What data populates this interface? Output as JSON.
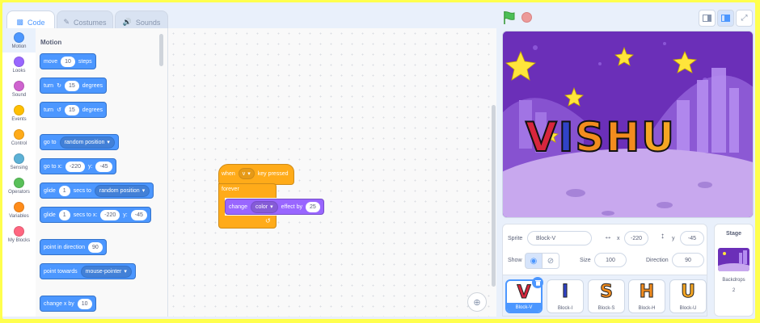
{
  "tabs": [
    {
      "label": "Code",
      "icon": "code-icon",
      "active": true
    },
    {
      "label": "Costumes",
      "icon": "brush-icon"
    },
    {
      "label": "Sounds",
      "icon": "speaker-icon"
    }
  ],
  "categories": [
    {
      "label": "Motion",
      "color": "#4c97ff"
    },
    {
      "label": "Looks",
      "color": "#9966ff"
    },
    {
      "label": "Sound",
      "color": "#cf63cf"
    },
    {
      "label": "Events",
      "color": "#ffbf00"
    },
    {
      "label": "Control",
      "color": "#ffab19"
    },
    {
      "label": "Sensing",
      "color": "#5cb1d6"
    },
    {
      "label": "Operators",
      "color": "#59c059"
    },
    {
      "label": "Variables",
      "color": "#ff8c1a"
    },
    {
      "label": "My Blocks",
      "color": "#ff6680"
    }
  ],
  "palette": {
    "title": "Motion",
    "move": {
      "a": "move",
      "n": "10",
      "b": "steps"
    },
    "turn_right": {
      "a": "turn",
      "n": "15",
      "b": "degrees"
    },
    "turn_left": {
      "a": "turn",
      "n": "15",
      "b": "degrees"
    },
    "goto": {
      "a": "go to",
      "dd": "random position"
    },
    "goto_xy": {
      "a": "go to x:",
      "x": "-220",
      "b": "y:",
      "y": "-45"
    },
    "glide_to": {
      "a": "glide",
      "n": "1",
      "b": "secs to",
      "dd": "random position"
    },
    "glide_xy": {
      "a": "glide",
      "n": "1",
      "b": "secs to x:",
      "x": "-220",
      "c": "y:",
      "y": "-45"
    },
    "point_dir": {
      "a": "point in direction",
      "n": "90"
    },
    "point_towards": {
      "a": "point towards",
      "dd": "mouse-pointer"
    },
    "change_x": {
      "a": "change x by",
      "n": "10"
    }
  },
  "script": {
    "hat": {
      "a": "when",
      "key": "v",
      "b": "key pressed"
    },
    "forever": "forever",
    "effect": {
      "a": "change",
      "dd": "color",
      "b": "effect by",
      "n": "25"
    }
  },
  "stage": {
    "title_text": "VISHU"
  },
  "sprite_info": {
    "sprite_label": "Sprite",
    "sprite_name": "Block-V",
    "x_label": "x",
    "x": "-220",
    "y_label": "y",
    "y": "-45",
    "show_label": "Show",
    "size_label": "Size",
    "size": "100",
    "direction_label": "Direction",
    "direction": "90"
  },
  "sprites": [
    {
      "name": "Block-V",
      "letter": "V",
      "color": "#d7263d",
      "selected": true
    },
    {
      "name": "Block-I",
      "letter": "I",
      "color": "#3043c7"
    },
    {
      "name": "Block-S",
      "letter": "S",
      "color": "#f28c1e"
    },
    {
      "name": "Block-H",
      "letter": "H",
      "color": "#f28c1e"
    },
    {
      "name": "Block-U",
      "letter": "U",
      "color": "#f5a623"
    }
  ],
  "stage_panel": {
    "title": "Stage",
    "backdrops_label": "Backdrops",
    "backdrops_count": "2"
  }
}
